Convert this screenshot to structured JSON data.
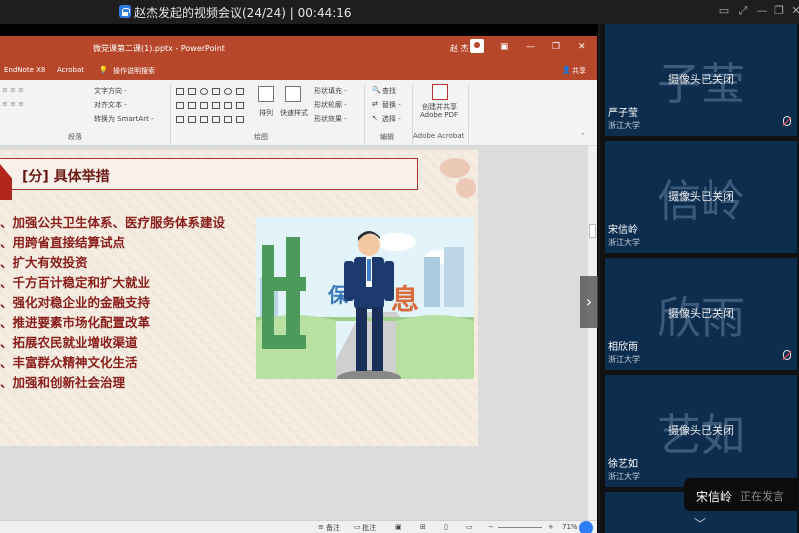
{
  "meeting": {
    "title": "赵杰发起的视频会议(24/24)",
    "separator": "|",
    "timer": "00:44:16"
  },
  "powerpoint": {
    "doc_title": "微党课第二课(1).pptx - PowerPoint",
    "user": "赵 杰",
    "tabs": [
      "EndNote X8",
      "Acrobat",
      "操作说明搜索"
    ],
    "share_label": "共享",
    "ribbon": {
      "paragraph_items": [
        "文字方向 -",
        "对齐文本 -",
        "转换为 SmartArt -"
      ],
      "arrange": "排列",
      "quick_styles": "快速样式",
      "shape_items": [
        "形状填充 -",
        "形状轮廓 -",
        "形状效果 -"
      ],
      "edit_items": [
        "查找",
        "替换 -",
        "选择 -"
      ],
      "acrobat_items": [
        "创建并共享",
        "Adobe PDF"
      ],
      "groups": [
        "段落",
        "绘图",
        "编辑",
        "Adobe Acrobat"
      ]
    },
    "slide": {
      "heading": "[分] 具体举措",
      "items": [
        "、加强公共卫生体系、医疗服务体系建设",
        "、用跨省直接结算试点",
        "、扩大有效投资",
        "、千方百计稳定和扩大就业",
        "、强化对稳企业的金融支持",
        "、推进要素市场化配置改革",
        "、拓展农民就业增收渠道",
        "、丰富群众精神文化生活",
        "、加强和创新社会治理"
      ],
      "picture_labels": [
        "民",
        "保",
        "息"
      ]
    },
    "status": {
      "notes": "备注",
      "comments": "批注",
      "zoom": "71%"
    }
  },
  "participants": [
    {
      "bg": "子莹",
      "status": "摄像头已关闭",
      "name": "严子莹",
      "org": "浙江大学"
    },
    {
      "bg": "信岭",
      "status": "摄像头已关闭",
      "name": "宋信岭",
      "org": "浙江大学"
    },
    {
      "bg": "欣雨",
      "status": "摄像头已关闭",
      "name": "相欣雨",
      "org": "浙江大学"
    },
    {
      "bg": "艺如",
      "status": "摄像头已关闭",
      "name": "徐艺如",
      "org": "浙江大学"
    }
  ],
  "speaking": {
    "name": "宋信岭",
    "status": "正在发言"
  },
  "icons": {
    "lock": "lock-icon",
    "scroll_up": "chevron-up-icon",
    "scroll_down": "chevron-down-icon",
    "next_slide": "chevron-right-icon"
  }
}
